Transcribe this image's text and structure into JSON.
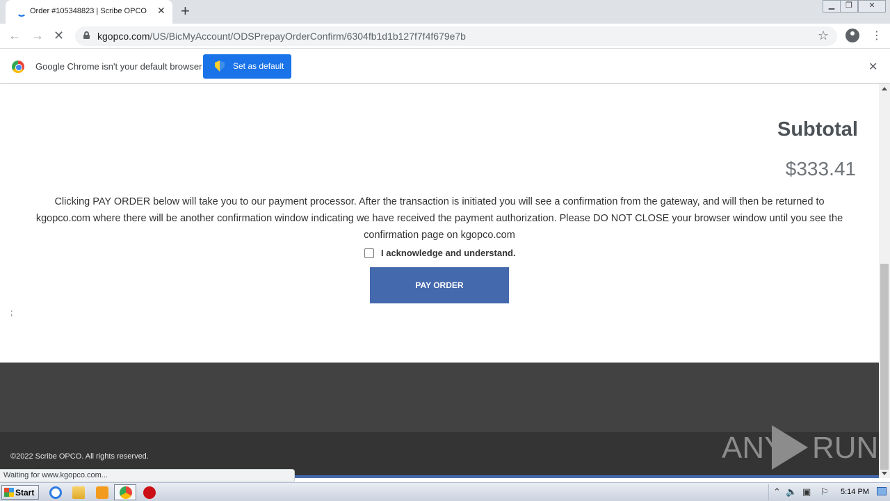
{
  "browser": {
    "tab_title": "Order #105348823 | Scribe OPCO",
    "url_domain": "kgopco.com",
    "url_path": "/US/BicMyAccount/ODSPrepayOrderConfirm/6304fb1d1b127f7f4f679e7b",
    "infobar_text": "Google Chrome isn't your default browser",
    "set_default_label": "Set as default",
    "status_text": "Waiting for www.kgopco.com..."
  },
  "page": {
    "subtotal_label": "Subtotal",
    "subtotal_value": "$333.41",
    "notice": "Clicking PAY ORDER below will take you to our payment processor. After the transaction is initiated you will see a confirmation from the gateway, and will then be returned to kgopco.com where there will be another confirmation window indicating we have received the payment authorization. Please DO NOT CLOSE your browser window until you see the confirmation page on kgopco.com",
    "acknowledge_label": "I acknowledge and understand.",
    "acknowledge_checked": false,
    "pay_button_label": "PAY ORDER",
    "stray_mark": ";",
    "footer_copyright": "©2022 Scribe OPCO. All rights reserved.",
    "watermark_left": "ANY",
    "watermark_right": "RUN"
  },
  "taskbar": {
    "start_label": "Start",
    "clock": "5:14 PM",
    "pinned_icons": [
      "internet-explorer-icon",
      "folder-icon",
      "media-player-icon",
      "chrome-icon",
      "opera-icon"
    ]
  },
  "colors": {
    "accent": "#1a73e8",
    "pay_button": "#4469ad",
    "footer_top": "#424242",
    "footer_bottom": "#343434"
  }
}
